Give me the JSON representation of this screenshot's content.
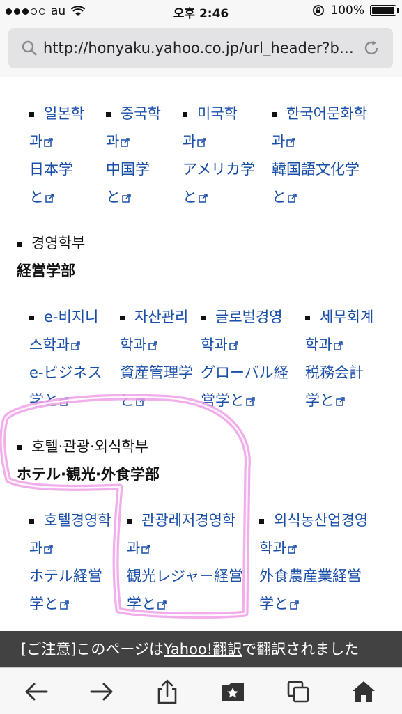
{
  "status_bar": {
    "carrier": "au",
    "time": "오후 2:46",
    "battery": "100%"
  },
  "address_bar": {
    "url": "http://honyaku.yahoo.co.jp/url_header?b…"
  },
  "sections": {
    "row1": [
      {
        "ko1": "일본학",
        "ko2": "과",
        "ja1": "日本学",
        "ja2": "と"
      },
      {
        "ko1": "중국학",
        "ko2": "과",
        "ja1": "中国学",
        "ja2": "と"
      },
      {
        "ko1": "미국학",
        "ko2": "과",
        "ja1": "アメリカ学",
        "ja2": "と"
      },
      {
        "ko1": "한국어문화학",
        "ko2": "과",
        "ja1": "韓国語文化学",
        "ja2": "と"
      }
    ],
    "dept2": {
      "ko": "경영학부",
      "ja": "経営学部"
    },
    "row2": [
      {
        "ko1": "e-비지니",
        "ko2": "스학과",
        "ja1": "e-ビジネス",
        "ja2": "学と"
      },
      {
        "ko1": "자산관리",
        "ko2": "학과",
        "ja1": "資産管理学",
        "ja2": "と"
      },
      {
        "ko1": "글로벌경영",
        "ko2": "학과",
        "ja1": "グローバル経",
        "ja2": "営学と"
      },
      {
        "ko1": "세무회계",
        "ko2": "학과",
        "ja1": "税務会計",
        "ja2": "学と"
      }
    ],
    "dept3": {
      "ko": "호텔·관광·외식학부",
      "ja": "ホテル·観光·外食学部"
    },
    "row3": [
      {
        "ko1": "호텔경영학",
        "ko2": "과",
        "ja1": "ホテル経営",
        "ja2": "学と"
      },
      {
        "ko1": "관광레저경영학",
        "ko2": "과",
        "ja1": "観光レジャー経営",
        "ja2": "学と"
      },
      {
        "ko1": "외식농산업경영",
        "ko2": "학과",
        "ja1": "外食農産業経営",
        "ja2": "学と"
      }
    ]
  },
  "notice": {
    "prefix": "[ご注意]",
    "mid": "このページは",
    "link": "Yahoo!翻訳",
    "suffix": "で翻訳されました"
  },
  "colors": {
    "link": "#1a4fa8",
    "highlight": "#f0a0e8"
  }
}
